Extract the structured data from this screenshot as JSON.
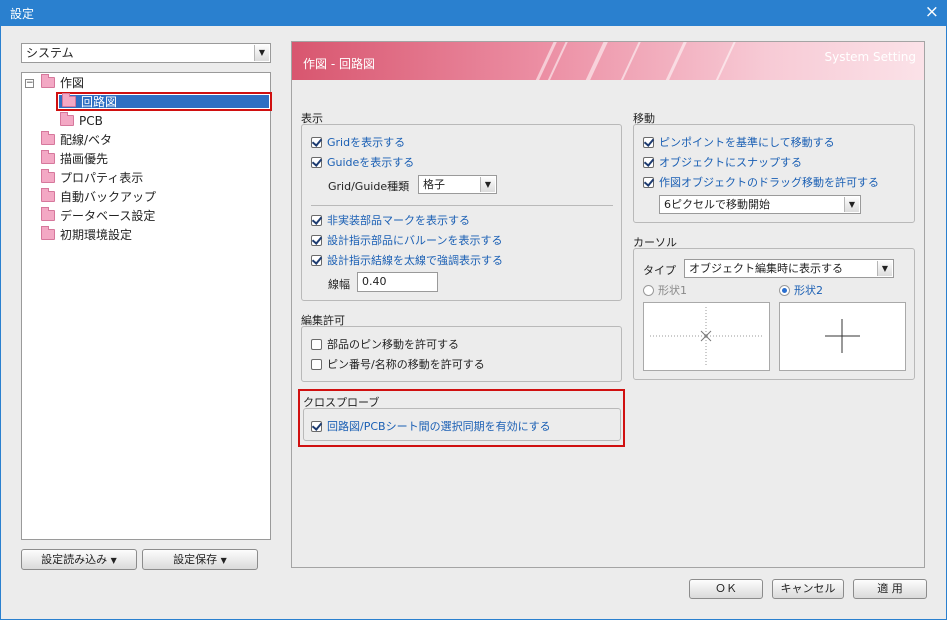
{
  "window": {
    "title": "設定",
    "close_icon": "×"
  },
  "left": {
    "category_select": "システム",
    "tree": {
      "root": "作図",
      "child_selected": "回路図",
      "child2": "PCB",
      "items": [
        "配線/ベタ",
        "描画優先",
        "プロパティ表示",
        "自動バックアップ",
        "データベース設定",
        "初期環境設定"
      ]
    },
    "load_button": "設定読み込み",
    "save_button": "設定保存"
  },
  "panel": {
    "header_title": "作図 - 回路図",
    "header_subtitle": "System Setting",
    "display": {
      "label": "表示",
      "show_grid": "Gridを表示する",
      "show_guide": "Guideを表示する",
      "grid_guide_type_label": "Grid/Guide種類",
      "grid_guide_type_value": "格子",
      "show_unmounted_mark": "非実装部品マークを表示する",
      "show_balloon": "設計指示部品にバルーンを表示する",
      "emphasize_wire": "設計指示結線を太線で強調表示する",
      "line_width_label": "線幅",
      "line_width_value": "0.40"
    },
    "edit_permission": {
      "label": "編集許可",
      "allow_pin_move": "部品のピン移動を許可する",
      "allow_pin_name_move": "ピン番号/名称の移動を許可する"
    },
    "cross_probe": {
      "label": "クロスプローブ",
      "enable_sync": "回路図/PCBシート間の選択同期を有効にする"
    },
    "move": {
      "label": "移動",
      "pin_point": "ピンポイントを基準にして移動する",
      "snap": "オブジェクトにスナップする",
      "drag": "作図オブジェクトのドラッグ移動を許可する",
      "drag_threshold": "6ピクセルで移動開始"
    },
    "cursor": {
      "label": "カーソル",
      "type_label": "タイプ",
      "type_value": "オブジェクト編集時に表示する",
      "shape1": "形状1",
      "shape2": "形状2"
    }
  },
  "footer": {
    "ok": "ＯＫ",
    "cancel": "キャンセル",
    "apply": "適 用"
  }
}
